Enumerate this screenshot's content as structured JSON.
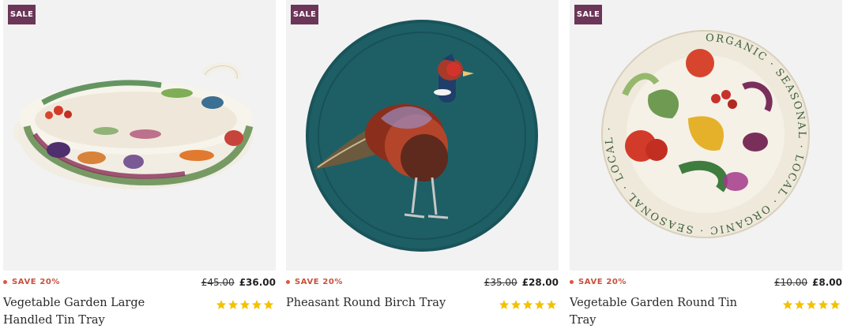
{
  "products": [
    {
      "image": "vegetable-garden-handled-tin-tray",
      "badge": "SALE",
      "discount": "SAVE 20%",
      "old_price": "£45.00",
      "price": "£36.00",
      "title": "Vegetable Garden Large Handled Tin Tray",
      "rating": 5
    },
    {
      "image": "pheasant-round-birch-tray",
      "badge": "SALE",
      "discount": "SAVE 20%",
      "old_price": "£35.00",
      "price": "£28.00",
      "title": "Pheasant Round Birch Tray",
      "rating": 5
    },
    {
      "image": "vegetable-garden-round-tin-tray",
      "badge": "SALE",
      "discount": "SAVE 20%",
      "old_price": "£10.00",
      "price": "£8.00",
      "title": "Vegetable Garden Round Tin Tray",
      "rating": 5,
      "plate_text": "ORGANIC · SEASONAL · LOCAL · ORGANIC · SEASONAL · LOCAL ·"
    }
  ],
  "colors": {
    "sale_badge": "#6b3657",
    "discount_text": "#c9503c",
    "star": "#f2c200",
    "birch_tray": "#1e5f66"
  }
}
